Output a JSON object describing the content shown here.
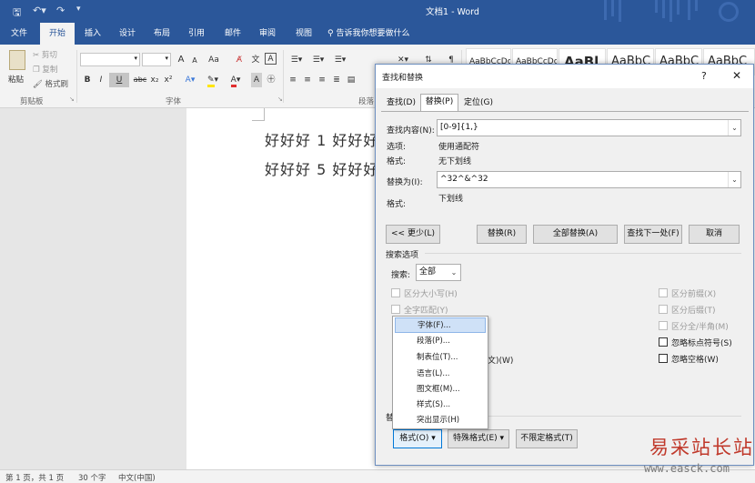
{
  "app": {
    "title": "文档1 - Word"
  },
  "ribbon_tabs": [
    "文件",
    "开始",
    "插入",
    "设计",
    "布局",
    "引用",
    "邮件",
    "审阅",
    "视图"
  ],
  "tell_me": "告诉我你想要做什么",
  "clipboard": {
    "paste": "粘贴",
    "cut": "剪切",
    "copy": "复制",
    "format_painter": "格式刷",
    "group": "剪贴板"
  },
  "font_group": {
    "group": "字体",
    "grow": "A",
    "shrink": "A",
    "clear": "Aa",
    "bold": "B",
    "italic": "I",
    "underline": "U",
    "strike": "abc",
    "sub": "x₂",
    "sup": "x²"
  },
  "paragraph_group": {
    "group": "段落"
  },
  "styles": [
    "AaBbCcDc",
    "AaBbCcDc",
    "AaBl",
    "AaBbC",
    "AaBbC",
    "AaBbC"
  ],
  "document": {
    "line1": "好好好  1  好好好",
    "line2": "好好好  5  好好好"
  },
  "status": {
    "page": "第 1 页，共 1 页",
    "words": "30 个字",
    "lang": "中文(中国)"
  },
  "dialog": {
    "title": "查找和替换",
    "help": "?",
    "close": "✕",
    "tabs": [
      "查找(D)",
      "替换(P)",
      "定位(G)"
    ],
    "find_label": "查找内容(N):",
    "find_value": "[0-9]{1,}",
    "options_label": "选项:",
    "options_value": "使用通配符",
    "format_label": "格式:",
    "find_format_value": "无下划线",
    "replace_label": "替换为(I):",
    "replace_value": "^32^&^32",
    "replace_format_label": "格式:",
    "replace_format_value": "下划线",
    "buttons": {
      "less": "<< 更少(L)",
      "replace": "替换(R)",
      "replace_all": "全部替换(A)",
      "find_next": "查找下一处(F)",
      "cancel": "取消"
    },
    "search_options_title": "搜索选项",
    "search_label": "搜索:",
    "search_value": "全部",
    "checkboxes_left": [
      "区分大小写(H)",
      "全字匹配(Y)"
    ],
    "hidden_partial": "文)(W)",
    "checkboxes_right": [
      "区分前缀(X)",
      "区分后缀(T)",
      "区分全/半角(M)",
      "忽略标点符号(S)",
      "忽略空格(W)"
    ],
    "replace_section_partial": "替",
    "bottom_buttons": {
      "format": "格式(O) ▾",
      "special": "特殊格式(E) ▾",
      "no_format": "不限定格式(T)"
    }
  },
  "format_menu": [
    "字体(F)...",
    "段落(P)...",
    "制表位(T)...",
    "语言(L)...",
    "图文框(M)...",
    "样式(S)...",
    "突出显示(H)"
  ],
  "watermark": {
    "cn": "易采站长站",
    "url": "www.easck.com"
  },
  "colors": {
    "word_blue": "#2b579a",
    "highlight": "#cfe1f7",
    "font_color_red": "#e03030",
    "highlight_yellow": "#ffe500"
  }
}
